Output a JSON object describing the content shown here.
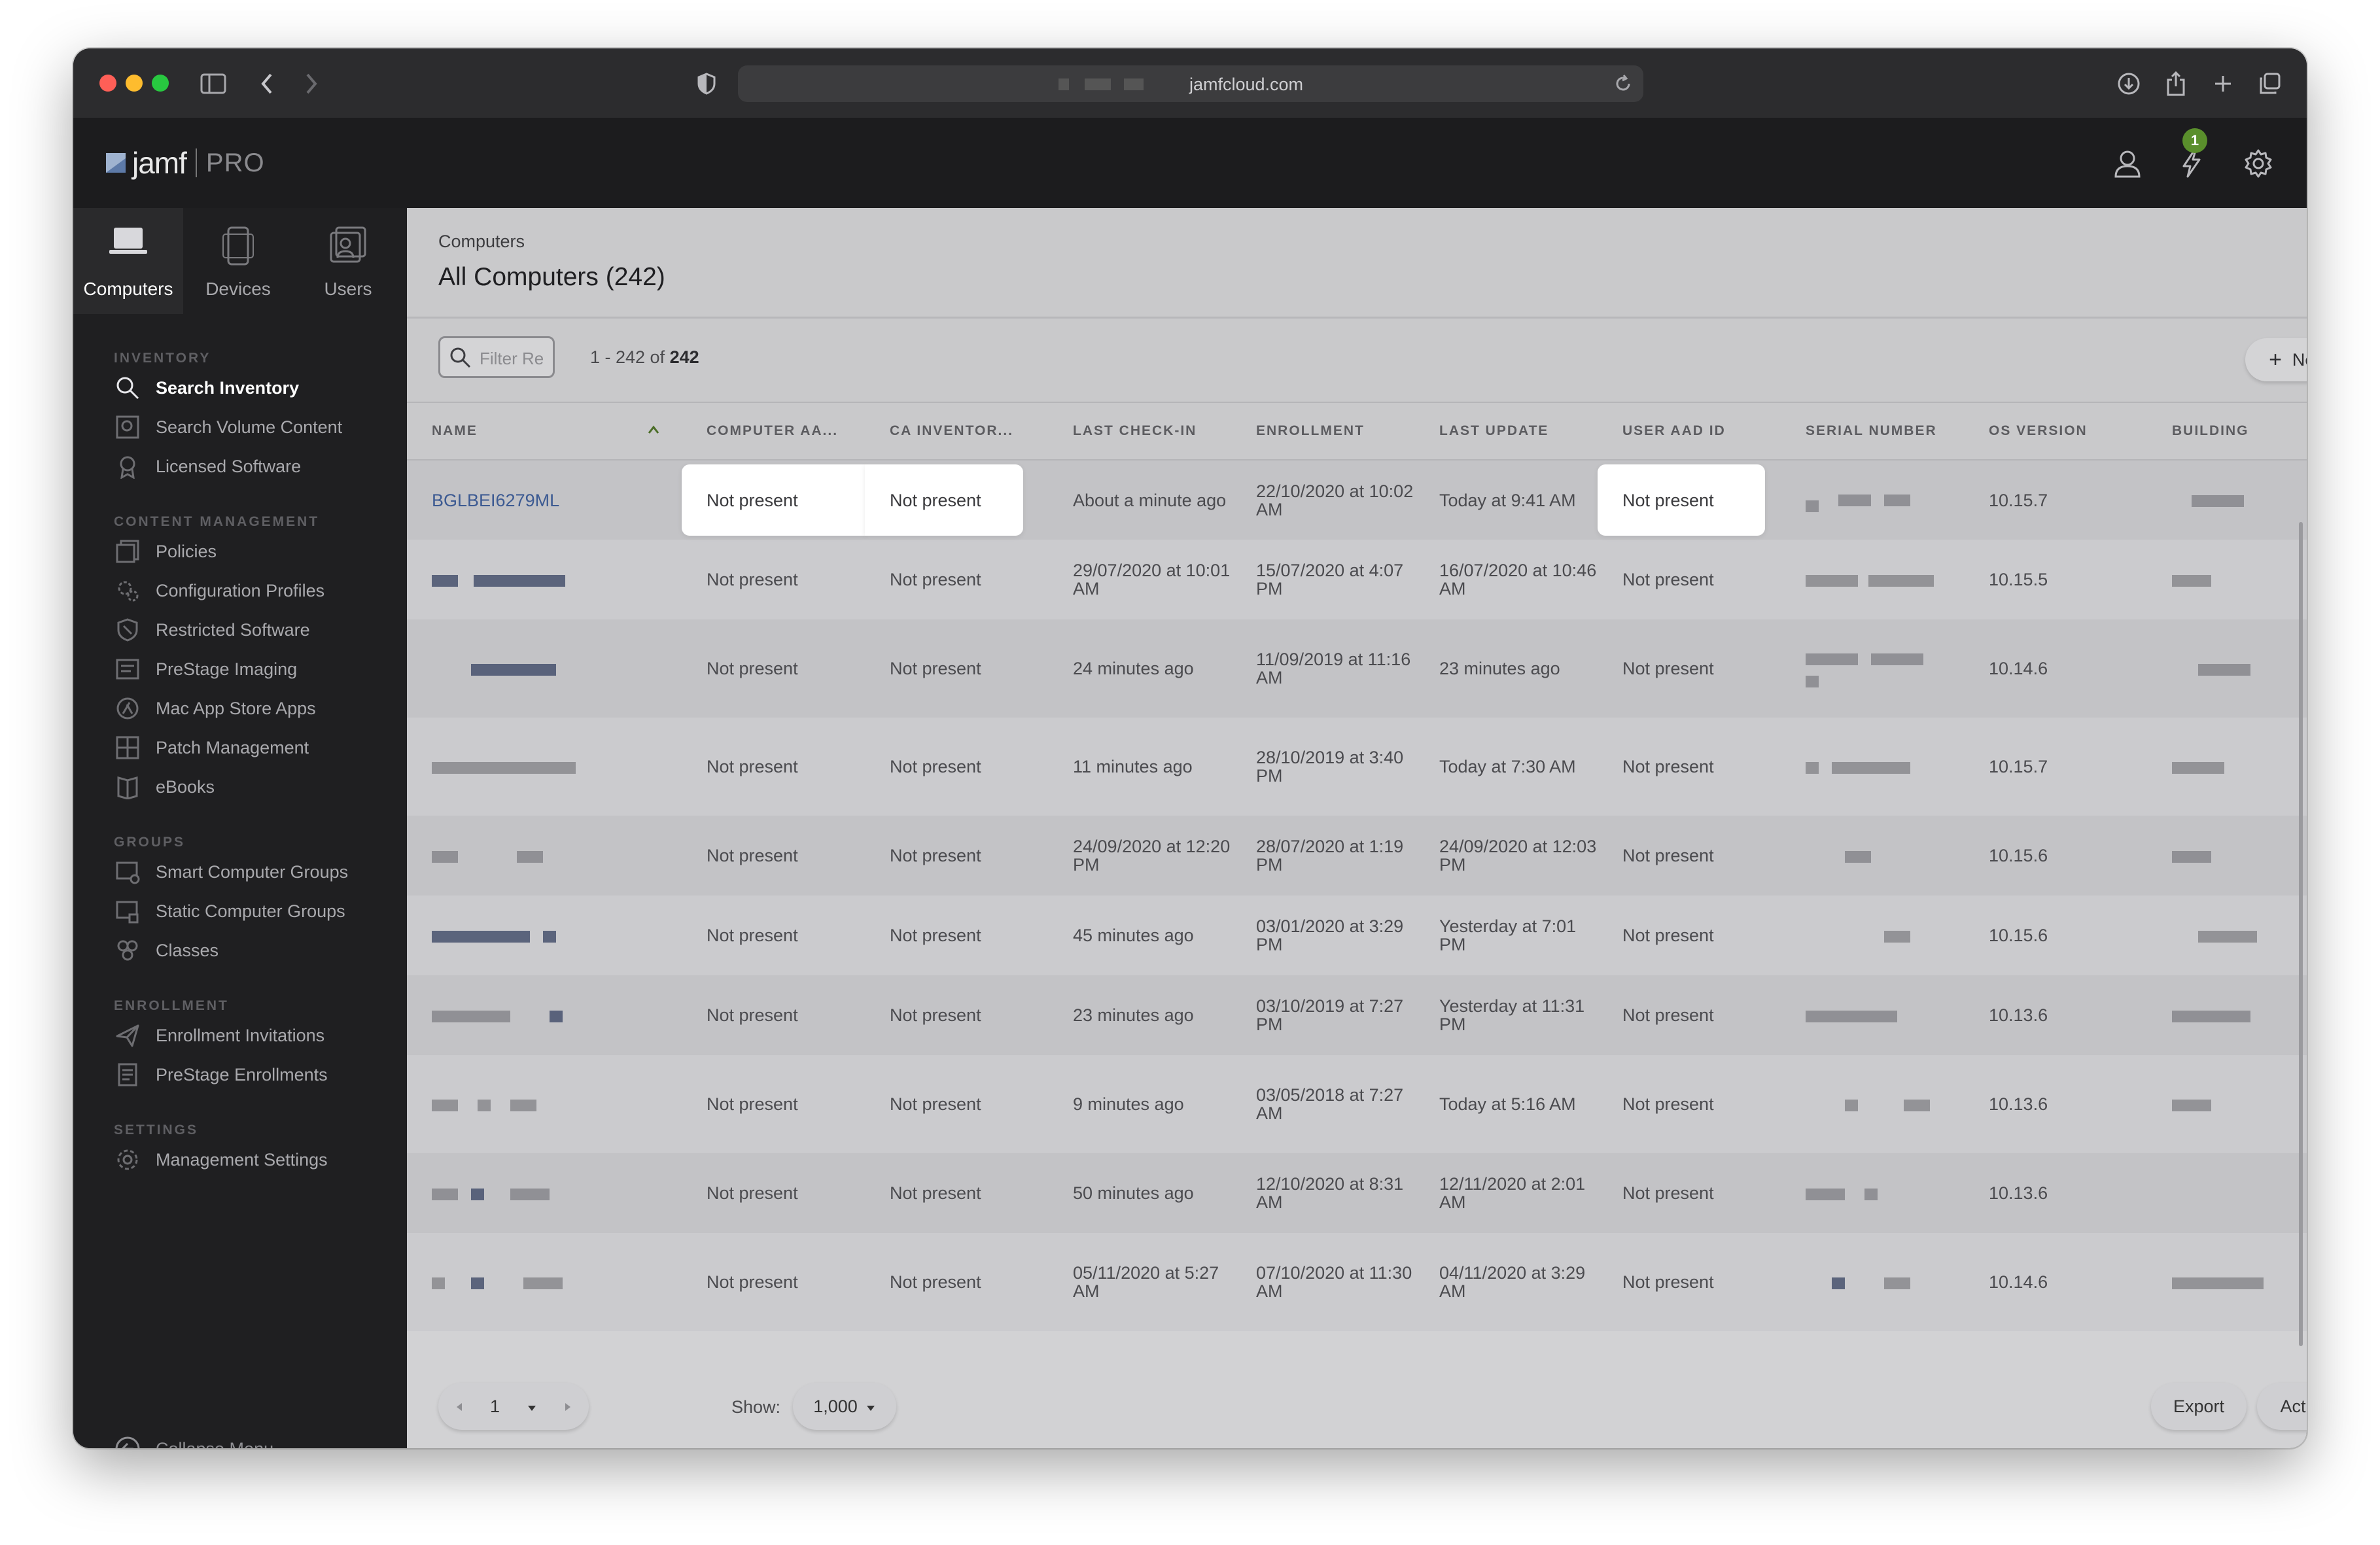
{
  "browser": {
    "url_domain": "jamfcloud.com",
    "traffic_colors": [
      "#ff5f57",
      "#febc2e",
      "#28c840"
    ]
  },
  "app": {
    "logo_text": "jamf",
    "logo_suffix": "PRO",
    "notification_count": "1",
    "accent_color": "#5a8f2c"
  },
  "nav_tabs": [
    {
      "label": "Computers",
      "icon": "laptop-icon",
      "active": true
    },
    {
      "label": "Devices",
      "icon": "mobile-device-icon",
      "active": false
    },
    {
      "label": "Users",
      "icon": "user-card-icon",
      "active": false
    }
  ],
  "sidebar": {
    "sections": [
      {
        "title": "INVENTORY",
        "items": [
          {
            "label": "Search Inventory",
            "icon": "search-icon",
            "active": true
          },
          {
            "label": "Search Volume Content",
            "icon": "volume-search-icon"
          },
          {
            "label": "Licensed Software",
            "icon": "license-icon"
          }
        ]
      },
      {
        "title": "CONTENT MANAGEMENT",
        "items": [
          {
            "label": "Policies",
            "icon": "policies-icon"
          },
          {
            "label": "Configuration Profiles",
            "icon": "gear-icon"
          },
          {
            "label": "Restricted Software",
            "icon": "shield-icon"
          },
          {
            "label": "PreStage Imaging",
            "icon": "imaging-icon"
          },
          {
            "label": "Mac App Store Apps",
            "icon": "app-store-icon"
          },
          {
            "label": "Patch Management",
            "icon": "patch-icon"
          },
          {
            "label": "eBooks",
            "icon": "book-icon"
          }
        ]
      },
      {
        "title": "GROUPS",
        "items": [
          {
            "label": "Smart Computer Groups",
            "icon": "smart-group-icon"
          },
          {
            "label": "Static Computer Groups",
            "icon": "static-group-icon"
          },
          {
            "label": "Classes",
            "icon": "classes-icon"
          }
        ]
      },
      {
        "title": "ENROLLMENT",
        "items": [
          {
            "label": "Enrollment Invitations",
            "icon": "paper-plane-icon"
          },
          {
            "label": "PreStage Enrollments",
            "icon": "enrollment-icon"
          }
        ]
      },
      {
        "title": "SETTINGS",
        "items": [
          {
            "label": "Management Settings",
            "icon": "gear-icon"
          }
        ]
      }
    ],
    "collapse_label": "Collapse Menu"
  },
  "page": {
    "breadcrumb": "Computers",
    "title": "All Computers (242)",
    "filter_placeholder": "Filter Re",
    "count_range": "1 - 242 of ",
    "count_total": "242",
    "new_label": "New"
  },
  "table": {
    "headers": [
      "NAME",
      "COMPUTER AA...",
      "CA INVENTOR...",
      "LAST CHECK-IN",
      "ENROLLMENT",
      "LAST UPDATE",
      "USER AAD ID",
      "SERIAL NUMBER",
      "OS VERSION",
      "BUILDING"
    ],
    "rows": [
      {
        "name": "BGLBEI6279ML",
        "computer_aad": "Not present",
        "ca_inventory": "Not present",
        "last_checkin": "About a minute ago",
        "enrollment": "22/10/2020 at 10:02 AM",
        "last_update": "Today at 9:41 AM",
        "user_aad_id": "Not present",
        "os_version": "10.15.7"
      },
      {
        "name": "",
        "computer_aad": "Not present",
        "ca_inventory": "Not present",
        "last_checkin": "29/07/2020 at 10:01 AM",
        "enrollment": "15/07/2020 at 4:07 PM",
        "last_update": "16/07/2020 at 10:46 AM",
        "user_aad_id": "Not present",
        "os_version": "10.15.5"
      },
      {
        "name": "",
        "computer_aad": "Not present",
        "ca_inventory": "Not present",
        "last_checkin": "24 minutes ago",
        "enrollment": "11/09/2019 at 11:16 AM",
        "last_update": "23 minutes ago",
        "user_aad_id": "Not present",
        "os_version": "10.14.6"
      },
      {
        "name": "",
        "computer_aad": "Not present",
        "ca_inventory": "Not present",
        "last_checkin": "11 minutes ago",
        "enrollment": "28/10/2019 at 3:40 PM",
        "last_update": "Today at 7:30 AM",
        "user_aad_id": "Not present",
        "os_version": "10.15.7"
      },
      {
        "name": "",
        "computer_aad": "Not present",
        "ca_inventory": "Not present",
        "last_checkin": "24/09/2020 at 12:20 PM",
        "enrollment": "28/07/2020 at 1:19 PM",
        "last_update": "24/09/2020 at 12:03 PM",
        "user_aad_id": "Not present",
        "os_version": "10.15.6"
      },
      {
        "name": "",
        "computer_aad": "Not present",
        "ca_inventory": "Not present",
        "last_checkin": "45 minutes ago",
        "enrollment": "03/01/2020 at 3:29 PM",
        "last_update": "Yesterday at 7:01 PM",
        "user_aad_id": "Not present",
        "os_version": "10.15.6"
      },
      {
        "name": "",
        "computer_aad": "Not present",
        "ca_inventory": "Not present",
        "last_checkin": "23 minutes ago",
        "enrollment": "03/10/2019 at 7:27 PM",
        "last_update": "Yesterday at 11:31 PM",
        "user_aad_id": "Not present",
        "os_version": "10.13.6"
      },
      {
        "name": "",
        "computer_aad": "Not present",
        "ca_inventory": "Not present",
        "last_checkin": "9 minutes ago",
        "enrollment": "03/05/2018 at 7:27 AM",
        "last_update": "Today at 5:16 AM",
        "user_aad_id": "Not present",
        "os_version": "10.13.6"
      },
      {
        "name": "",
        "computer_aad": "Not present",
        "ca_inventory": "Not present",
        "last_checkin": "50 minutes ago",
        "enrollment": "12/10/2020 at 8:31 AM",
        "last_update": "12/11/2020 at 2:01 AM",
        "user_aad_id": "Not present",
        "os_version": "10.13.6"
      },
      {
        "name": "",
        "computer_aad": "Not present",
        "ca_inventory": "Not present",
        "last_checkin": "05/11/2020 at 5:27 AM",
        "enrollment": "07/10/2020 at 11:30 AM",
        "last_update": "04/11/2020 at 3:29 AM",
        "user_aad_id": "Not present",
        "os_version": "10.14.6"
      }
    ]
  },
  "footer": {
    "page_number": "1",
    "show_label": "Show:",
    "show_value": "1,000",
    "export_label": "Export",
    "action_label": "Action"
  }
}
